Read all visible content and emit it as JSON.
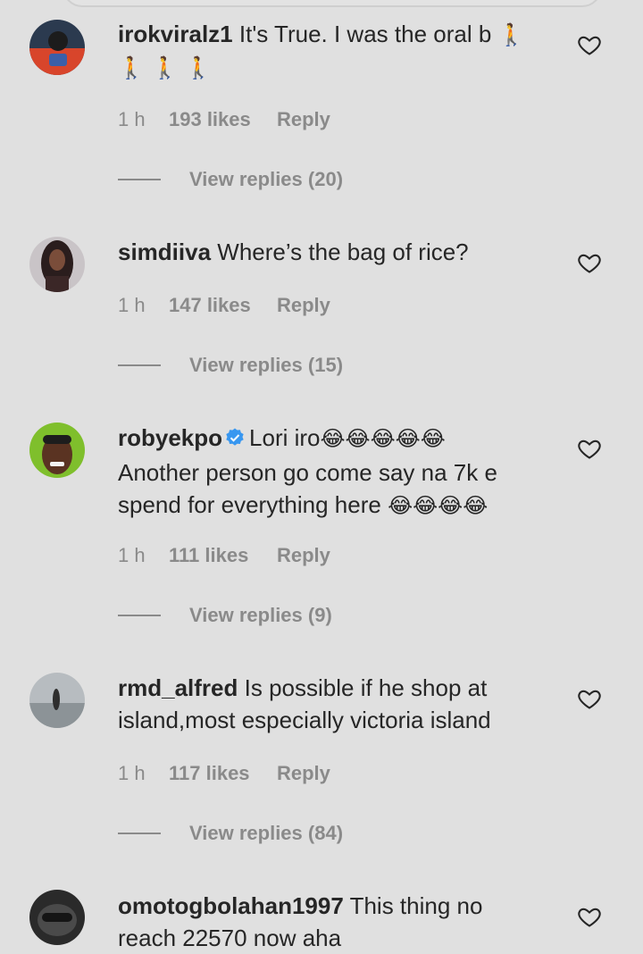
{
  "comments": [
    {
      "username": "irokviralz1",
      "text": "It's True. I was the oral b",
      "text_emojis": "🚶",
      "line2_emojis": "🚶 🚶 🚶",
      "time": "1 h",
      "likes": "193 likes",
      "reply_label": "Reply",
      "view_replies": "View replies (20)"
    },
    {
      "username": "simdiiva",
      "text": "Where’s the bag of rice?",
      "time": "1 h",
      "likes": "147 likes",
      "reply_label": "Reply",
      "view_replies": "View replies (15)"
    },
    {
      "username": "robyekpo",
      "verified": true,
      "text": "Lori iro",
      "text_emojis": "😂😂😂😂😂",
      "line2": "Another person go come say na 7k e",
      "line3": "spend for everything here",
      "line3_emojis": "😂😂😂😂",
      "time": "1 h",
      "likes": "111 likes",
      "reply_label": "Reply",
      "view_replies": "View replies (9)"
    },
    {
      "username": "rmd_alfred",
      "text": "Is possible if he shop at",
      "line2": "island,most especially victoria island",
      "time": "1 h",
      "likes": "117 likes",
      "reply_label": "Reply",
      "view_replies": "View replies (84)"
    },
    {
      "username": "omotogbolahan1997",
      "text": "This thing no",
      "line2": "reach 22570 now aha"
    }
  ],
  "colors": {
    "background": "#e0e0e0",
    "text": "#262626",
    "meta": "#8a8a8a",
    "verified": "#3897f0"
  },
  "icons": [
    "heart-icon",
    "verified-badge-icon",
    "avatar"
  ]
}
